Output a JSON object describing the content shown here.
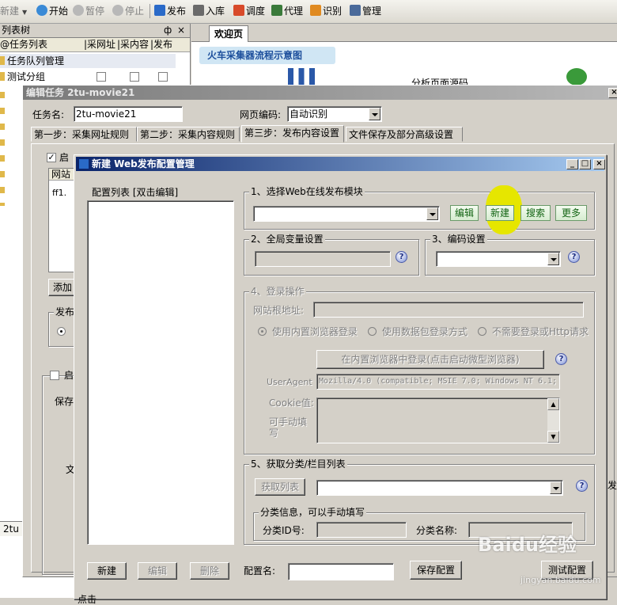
{
  "toolbar": {
    "items": [
      {
        "label": "新建",
        "icon": "new-icon",
        "disabled": true
      },
      {
        "label": "开始",
        "icon": "play-icon",
        "disabled": false
      },
      {
        "label": "暂停",
        "icon": "pause-icon",
        "disabled": true
      },
      {
        "label": "停止",
        "icon": "stop-icon",
        "disabled": true
      },
      {
        "label": "发布",
        "icon": "publish-icon",
        "disabled": false
      },
      {
        "label": "入库",
        "icon": "sql-icon",
        "disabled": false
      },
      {
        "label": "调度",
        "icon": "schedule-icon",
        "disabled": false
      },
      {
        "label": "代理",
        "icon": "proxy-icon",
        "disabled": false
      },
      {
        "label": "识别",
        "icon": "ocr-icon",
        "disabled": false
      },
      {
        "label": "管理",
        "icon": "manage-icon",
        "disabled": false
      }
    ]
  },
  "left_panel": {
    "title": "列表树",
    "pin": "ф",
    "close": "×",
    "columns": [
      "@任务列表",
      "|采网址",
      "|采内容",
      "|发布"
    ],
    "tree_items": [
      "任务队列管理",
      "测试分组"
    ],
    "status_text": "2tu"
  },
  "welcome": {
    "tab_label": "欢迎页",
    "flow_title": "火车采集器流程示意图",
    "flow_text": "分析页面源码"
  },
  "edit_task": {
    "title": "编辑任务 2tu-movie21",
    "task_name_label": "任务名:",
    "task_name_value": "2tu-movie21",
    "encoding_label": "网页编码:",
    "encoding_value": "自动识别",
    "tabs": [
      "第一步：采集网址规则",
      "第二步：采集内容规则",
      "第三步：发布内容设置",
      "文件保存及部分高级设置"
    ],
    "active_tab": 2,
    "enable_label": "启",
    "list_header": "网站",
    "list_row": "ff1.",
    "add_button": "添加",
    "publish_group": "发布",
    "enable2_label": "启",
    "save_label": "保存",
    "text_label": "文",
    "right_label": "发"
  },
  "dialog": {
    "title": "新建 Web发布配置管理",
    "config_list_label": "配置列表 [双击编辑]",
    "section1": {
      "label": "1、选择Web在线发布模块",
      "combo_value": "",
      "buttons": [
        "编辑",
        "新建",
        "搜索",
        "更多"
      ]
    },
    "section2": {
      "label": "2、全局变量设置"
    },
    "section3": {
      "label": "3、编码设置",
      "combo_value": ""
    },
    "section4": {
      "label": "4、登录操作",
      "root_url_label": "网站根地址:",
      "radios": [
        "使用内置浏览器登录",
        "使用数据包登录方式",
        "不需要登录或Http请求"
      ],
      "login_button": "在内置浏览器中登录(点击启动微型浏览器)",
      "useragent_label": "UserAgent",
      "useragent_value": "Mozilla/4.0 (compatible; MSIE 7.0; Windows NT 6.1;",
      "cookie_label": "Cookie值:",
      "manual_label_1": "可手动填",
      "manual_label_2": "写"
    },
    "section5": {
      "label": "5、获取分类/栏目列表",
      "fetch_button": "获取列表",
      "combo_value": "",
      "category_group": "分类信息，可以手动填写",
      "category_id_label": "分类ID号:",
      "category_name_label": "分类名称:"
    },
    "bottom": {
      "new_button": "新建",
      "edit_button": "编辑",
      "delete_button": "删除",
      "config_name_label": "配置名:",
      "config_name_value": "",
      "save_button": "保存配置",
      "test_button": "测试配置"
    },
    "footer_text": "点击"
  },
  "watermark": {
    "text": "Baidu经验",
    "url": "jingyan.baidu.com"
  },
  "colors": {
    "highlight": "#e6e600",
    "green_button_text": "#126412",
    "active_title": "#0a246a"
  }
}
